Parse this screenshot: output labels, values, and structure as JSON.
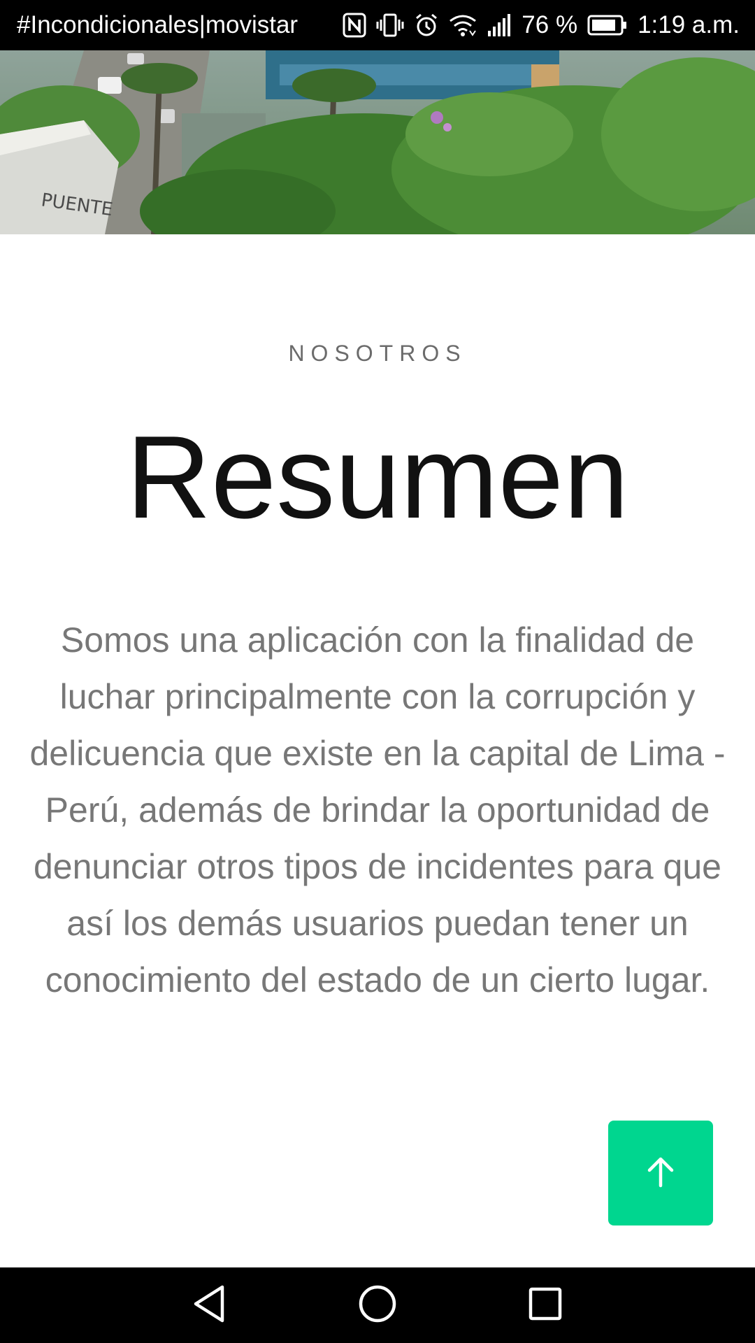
{
  "status_bar": {
    "carrier": "#Incondicionales|movistar",
    "battery_percent": "76 %",
    "time": "1:19 a.m.",
    "icons": [
      "nfc-icon",
      "vibrate-icon",
      "alarm-icon",
      "wifi-icon",
      "signal-icon",
      "battery-icon"
    ]
  },
  "hero": {
    "image": "hero-photo-bridge-greenery",
    "sign_text": "PUENTE"
  },
  "section": {
    "eyebrow": "NOSOTROS",
    "title": "Resumen",
    "body": "Somos una aplicación con la finalidad de luchar principalmente con la corrupción y delicuencia que existe en la capital de Lima - Perú, además de brindar la oportunidad de denunciar otros tipos de incidentes para que así los demás usuarios puedan tener un conocimiento del estado de un cierto lugar."
  },
  "fab": {
    "icon": "arrow-up-icon",
    "color": "#00d68f"
  },
  "nav_bar": {
    "buttons": [
      "back-icon",
      "home-icon",
      "recents-icon"
    ]
  }
}
